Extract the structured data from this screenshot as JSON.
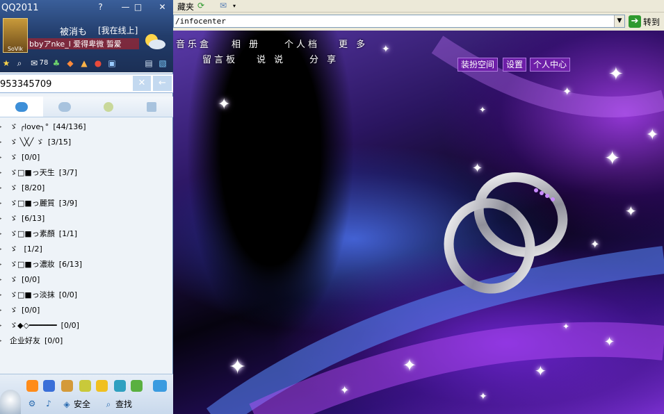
{
  "browser": {
    "favorites_label": "藏夹",
    "address": "/infocenter",
    "go_label": "转到"
  },
  "space": {
    "nav_row1": [
      "音乐盒",
      "相 册",
      "个人档",
      "更 多"
    ],
    "nav_row2": [
      "留言板",
      "说 说",
      "分 享"
    ],
    "buttons": [
      "装扮空间",
      "设置",
      "个人中心"
    ]
  },
  "qq": {
    "title": "QQ2011",
    "win_buttons": [
      "?",
      "—",
      "□",
      "✕"
    ],
    "nickname": "被消も",
    "status": "[我在线上]",
    "signature": "bbyアnke_l 爱得卑微 誓爱",
    "signature_tail": "...",
    "avatar_caption": "SoVik",
    "toolbar_count": "78",
    "search_value": "953345709",
    "search_clear": "✕",
    "search_go": "←",
    "groups": [
      {
        "name": "ゞ ╭love╮°",
        "count": "[44/136]"
      },
      {
        "name": "ゞ ╲╳╱ ゞ",
        "count": "[3/15]"
      },
      {
        "name": "ゞ",
        "count": "[0/0]"
      },
      {
        "name": "ゞ□■っ天生",
        "count": "[3/7]"
      },
      {
        "name": "ゞ",
        "count": "[8/20]"
      },
      {
        "name": "ゞ□■っ麗質",
        "count": "[3/9]"
      },
      {
        "name": "ゞ",
        "count": "[6/13]"
      },
      {
        "name": "ゞ□■っ素顏",
        "count": "[1/1]"
      },
      {
        "name": "ゞ ",
        "count": "[1/2]"
      },
      {
        "name": "ゞ□■っ濃妝",
        "count": "[6/13]"
      },
      {
        "name": "ゞ",
        "count": "[0/0]"
      },
      {
        "name": "ゞ□■っ淡抹",
        "count": "[0/0]"
      },
      {
        "name": "ゞ",
        "count": "[0/0]"
      },
      {
        "name": "ゞ◆◇━━━━━━",
        "count": "[0/0]"
      },
      {
        "name": "企业好友",
        "count": "[0/0]"
      }
    ],
    "bottom": {
      "security_label": "安全",
      "find_label": "查找"
    }
  },
  "colors": {
    "qq_header": "#223c6a",
    "space_button": "#6e1fa8",
    "go_green": "#2f9a2f"
  }
}
